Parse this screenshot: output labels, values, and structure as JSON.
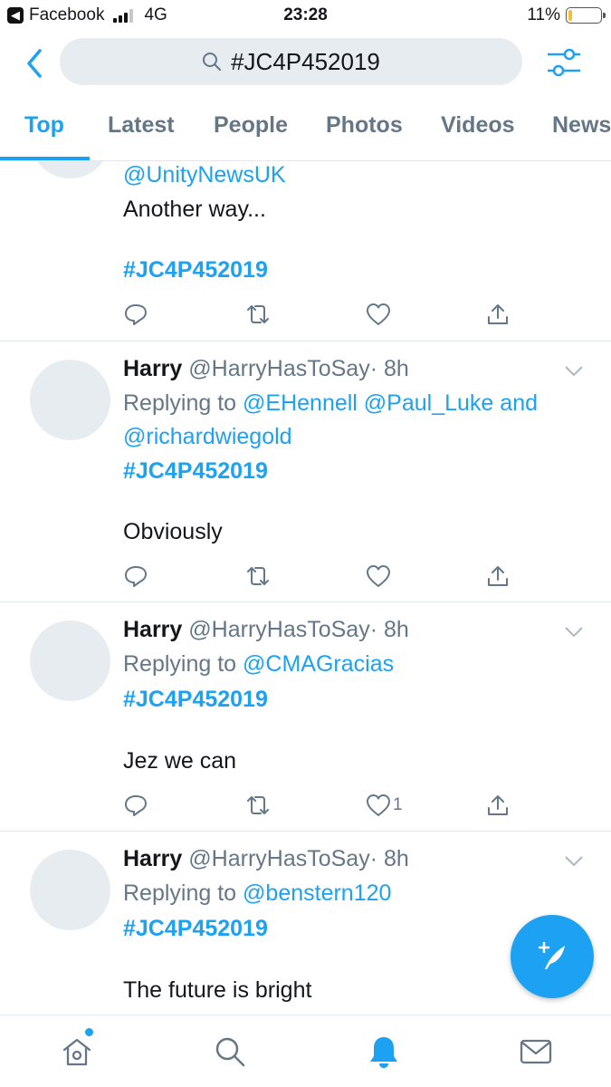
{
  "status_bar": {
    "back_app": "Facebook",
    "network": "4G",
    "time": "23:28",
    "battery": "11%",
    "battery_level": 0.11
  },
  "search": {
    "query": "#JC4P452019"
  },
  "tabs": [
    {
      "label": "Top",
      "active": true
    },
    {
      "label": "Latest"
    },
    {
      "label": "People"
    },
    {
      "label": "Photos"
    },
    {
      "label": "Videos"
    },
    {
      "label": "News"
    }
  ],
  "tweets": [
    {
      "mention": "@UnityNewsUK",
      "text": "Another way...",
      "hashtag": "#JC4P452019"
    },
    {
      "name": "Harry",
      "handle": "@HarryHasToSay",
      "time": "· 8h",
      "replying_prefix": "Replying to",
      "replying_1": "@EHennell @Paul_Luke",
      "replying_and": "and",
      "replying_2": "@richardwiegold",
      "hashtag": "#JC4P452019",
      "text": "Obviously"
    },
    {
      "name": "Harry",
      "handle": "@HarryHasToSay",
      "time": "· 8h",
      "replying_prefix": "Replying to",
      "replying_1": "@CMAGracias",
      "hashtag": "#JC4P452019",
      "text": "Jez we can",
      "like_count": "1"
    },
    {
      "name": "Harry",
      "handle": "@HarryHasToSay",
      "time": "· 8h",
      "replying_prefix": "Replying to",
      "replying_1": "@benstern120",
      "hashtag": "#JC4P452019",
      "text": "The future is bright"
    }
  ],
  "icons": {
    "back": "chevron-left-icon",
    "search": "search-icon",
    "filter": "filter-sliders-icon",
    "reply": "reply-icon",
    "retweet": "retweet-icon",
    "like": "heart-icon",
    "share": "share-icon",
    "compose": "compose-tweet-icon",
    "home": "home-icon",
    "explore": "search-icon",
    "notifications": "bell-icon",
    "messages": "mail-icon"
  },
  "colors": {
    "accent": "#1da1f2",
    "muted": "#657786",
    "avatar": "#e6ecf0"
  }
}
